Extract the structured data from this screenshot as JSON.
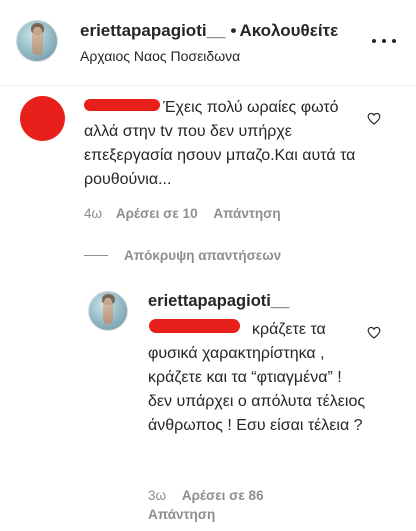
{
  "header": {
    "username": "eriettapapagioti__",
    "dot": "•",
    "follow_label": "Ακολουθείτε",
    "location": "Αρχαιος Ναος Ποσειδωνα",
    "more_icon": "more-horizontal-icon"
  },
  "comments": [
    {
      "author_redacted": true,
      "text": "Έχεις πολύ ωραίες φωτό αλλά στην tv που δεν υπήρχε επεξεργασία ησουν μπαζο.Και αυτά τα ρουθούνια...",
      "time": "4ω",
      "likes": "Αρέσει σε 10",
      "reply_label": "Απάντηση",
      "heart_icon": "heart-outline-icon"
    }
  ],
  "hide_replies_label": "Απόκρυψη απαντήσεων",
  "replies": [
    {
      "username": "eriettapapagioti__",
      "mention_redacted": true,
      "text": "κράζετε τα φυσικά χαρακτηρίστηκα , κράζετε και τα “φτιαγμένα” ! δεν υπάρχει ο απόλυτα τέλειος άνθρωπος ! Εσυ είσαι τέλεια ?",
      "time": "3ω",
      "likes": "Αρέσει σε 86",
      "reply_label": "Απάντηση",
      "heart_icon": "heart-outline-icon"
    }
  ],
  "colors": {
    "text": "#262626",
    "secondary": "#8e8e8e",
    "redaction": "#e8201c"
  }
}
